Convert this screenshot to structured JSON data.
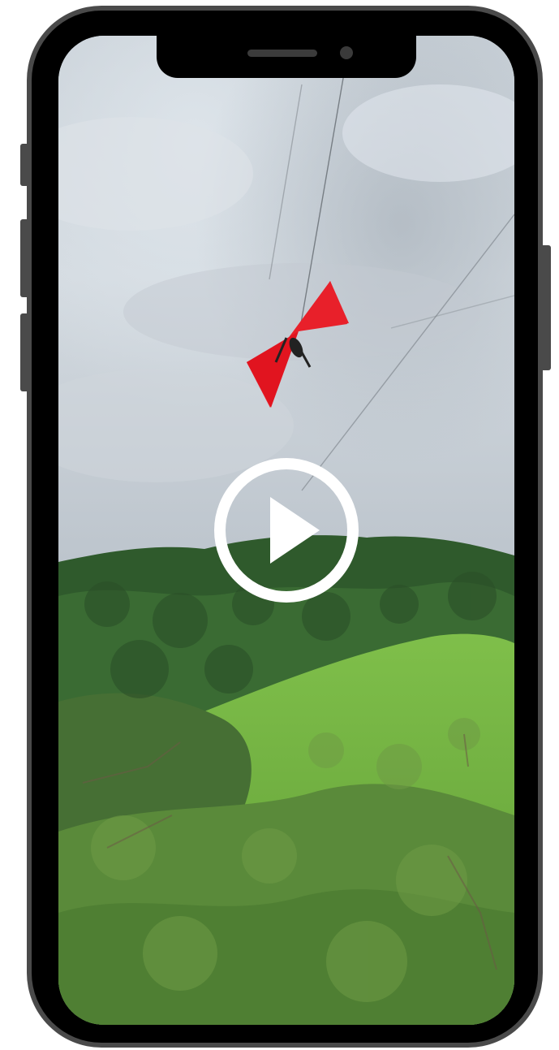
{
  "device": {
    "model_icon": "smartphone-frame",
    "frame_color": "#4a4a4a",
    "bezel_color": "#000000"
  },
  "video": {
    "state": "paused",
    "scene_icons": [
      "sky",
      "cables",
      "red-kite-flyer",
      "forest-hill"
    ],
    "accent_color": "#e8202a"
  },
  "controls": {
    "play_icon": "play-circle-icon",
    "play_color": "#ffffff"
  }
}
